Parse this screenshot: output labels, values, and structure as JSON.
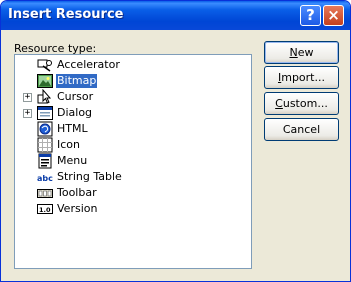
{
  "dialog": {
    "title": "Insert Resource",
    "help_button": "?",
    "close_button": "×"
  },
  "resource_type_label": "Resource type:",
  "resources": [
    {
      "label": "Accelerator",
      "icon": "accelerator-icon",
      "expandable": false,
      "selected": false
    },
    {
      "label": "Bitmap",
      "icon": "bitmap-icon",
      "expandable": false,
      "selected": true
    },
    {
      "label": "Cursor",
      "icon": "cursor-icon",
      "expandable": true,
      "selected": false
    },
    {
      "label": "Dialog",
      "icon": "dialog-icon",
      "expandable": true,
      "selected": false
    },
    {
      "label": "HTML",
      "icon": "html-icon",
      "expandable": false,
      "selected": false
    },
    {
      "label": "Icon",
      "icon": "icon-resource-icon",
      "expandable": false,
      "selected": false
    },
    {
      "label": "Menu",
      "icon": "menu-icon",
      "expandable": false,
      "selected": false
    },
    {
      "label": "String Table",
      "icon": "string-table-icon",
      "expandable": false,
      "selected": false,
      "icon_text": "abc"
    },
    {
      "label": "Toolbar",
      "icon": "toolbar-icon",
      "expandable": false,
      "selected": false
    },
    {
      "label": "Version",
      "icon": "version-icon",
      "expandable": false,
      "selected": false,
      "icon_text": "1.0"
    }
  ],
  "expand_glyph": "+",
  "buttons": {
    "new": {
      "first": "N",
      "rest": "ew"
    },
    "import": {
      "first": "I",
      "rest": "mport..."
    },
    "custom": {
      "first": "C",
      "rest": "ustom..."
    },
    "cancel": "Cancel"
  },
  "colors": {
    "titlebar": "#0a5fe8",
    "dialog_bg": "#ece9d8",
    "selection": "#316ac5"
  }
}
